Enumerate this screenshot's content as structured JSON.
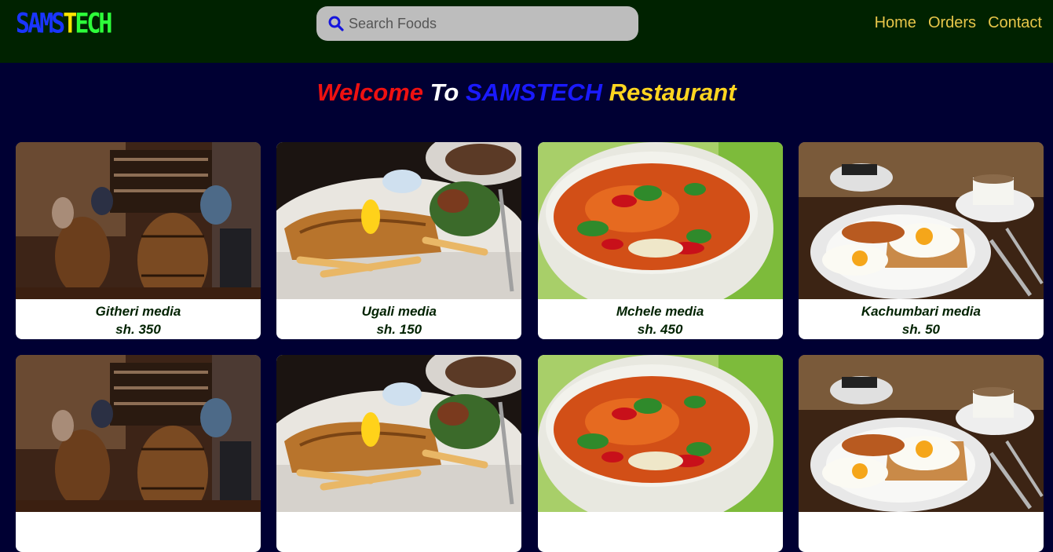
{
  "header": {
    "logo": {
      "part1": "SAMS",
      "part2": "T",
      "part3": "ECH"
    },
    "search": {
      "placeholder": "Search Foods",
      "icon": "search-icon"
    },
    "nav": [
      "Home",
      "Orders",
      "Contact"
    ]
  },
  "welcome": {
    "part1": "Welcome",
    "part2": "To",
    "part3": "SAMSTECH",
    "part4": "Restaurant"
  },
  "foods": [
    {
      "name": "Githeri media",
      "price": "sh. 350",
      "image": "restaurant-interior"
    },
    {
      "name": "Ugali media",
      "price": "sh. 150",
      "image": "fish-and-chips"
    },
    {
      "name": "Mchele media",
      "price": "sh. 450",
      "image": "soup-bowl"
    },
    {
      "name": "Kachumbari media",
      "price": "sh. 50",
      "image": "breakfast-plate"
    },
    {
      "name": "",
      "price": "",
      "image": "restaurant-interior"
    },
    {
      "name": "",
      "price": "",
      "image": "fish-and-chips"
    },
    {
      "name": "",
      "price": "",
      "image": "soup-bowl"
    },
    {
      "name": "",
      "price": "",
      "image": "breakfast-plate"
    }
  ],
  "colors": {
    "header_bg": "#002200",
    "page_bg": "#000033",
    "nav_link": "#e8c64a",
    "card_text": "#002200"
  }
}
